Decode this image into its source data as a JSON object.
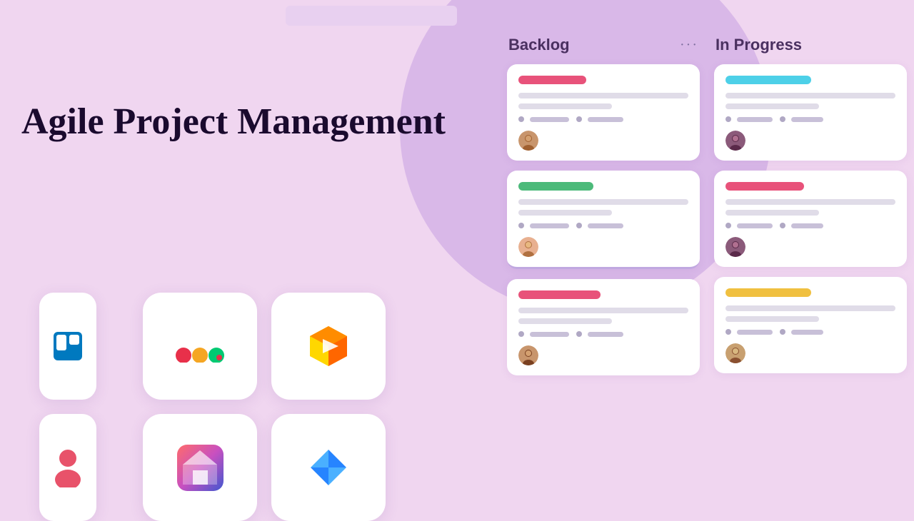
{
  "page": {
    "title": "Agile Project Management",
    "background_color": "#f0d6f0",
    "search_placeholder": ""
  },
  "kanban": {
    "columns": [
      {
        "id": "backlog",
        "title": "Backlog",
        "dots": "···",
        "cards": [
          {
            "tag_color": "pink",
            "tag_width": 95,
            "lines": [
              "full",
              "short"
            ],
            "badge1_width": 55,
            "badge2_width": 50,
            "avatar_type": "female1"
          },
          {
            "tag_color": "green",
            "tag_width": 105,
            "lines": [
              "full",
              "short"
            ],
            "badge1_width": 55,
            "badge2_width": 50,
            "avatar_type": "female1"
          },
          {
            "tag_color": "pink",
            "tag_width": 115,
            "lines": [
              "full",
              "short"
            ],
            "badge1_width": 55,
            "badge2_width": 50,
            "avatar_type": "female1"
          }
        ]
      },
      {
        "id": "in_progress",
        "title": "In Progress",
        "dots": "",
        "cards": [
          {
            "tag_color": "cyan",
            "tag_width": 120,
            "lines": [
              "full",
              "short"
            ],
            "badge1_width": 55,
            "badge2_width": 50,
            "avatar_type": "female2"
          },
          {
            "tag_color": "pink",
            "tag_width": 110,
            "lines": [
              "full",
              "short"
            ],
            "badge1_width": 55,
            "badge2_width": 50,
            "avatar_type": "female2"
          },
          {
            "tag_color": "yellow",
            "tag_width": 120,
            "lines": [
              "full",
              "short"
            ],
            "badge1_width": 55,
            "badge2_width": 50,
            "avatar_type": "female2"
          }
        ]
      }
    ]
  },
  "apps": [
    {
      "name": "Trello",
      "icon_type": "trello"
    },
    {
      "name": "Monday",
      "icon_type": "monday"
    },
    {
      "name": "Box",
      "icon_type": "box"
    },
    {
      "name": "Person",
      "icon_type": "person"
    },
    {
      "name": "Notion",
      "icon_type": "notion"
    },
    {
      "name": "Jira",
      "icon_type": "jira"
    }
  ]
}
